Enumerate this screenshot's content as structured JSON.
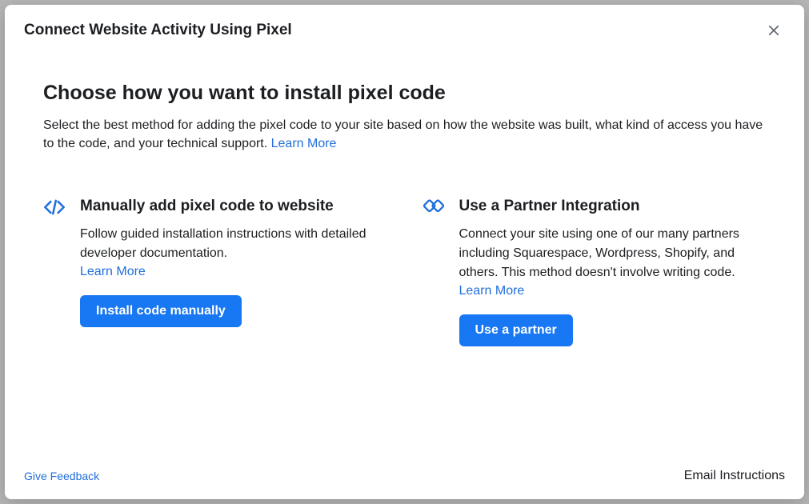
{
  "modal": {
    "title": "Connect Website Activity Using Pixel",
    "heading": "Choose how you want to install pixel code",
    "subtext": "Select the best method for adding the pixel code to your site based on how the website was built, what kind of access you have to the code, and your technical support. ",
    "subtext_link": "Learn More"
  },
  "options": {
    "manual": {
      "title": "Manually add pixel code to website",
      "desc": "Follow guided installation instructions with detailed developer documentation.",
      "link": "Learn More",
      "button": "Install code manually"
    },
    "partner": {
      "title": "Use a Partner Integration",
      "desc": "Connect your site using one of our many partners including Squarespace, Wordpress, Shopify, and others. This method doesn't involve writing code.",
      "link": "Learn More",
      "button": "Use a partner"
    }
  },
  "footer": {
    "feedback": "Give Feedback",
    "email": "Email Instructions"
  }
}
